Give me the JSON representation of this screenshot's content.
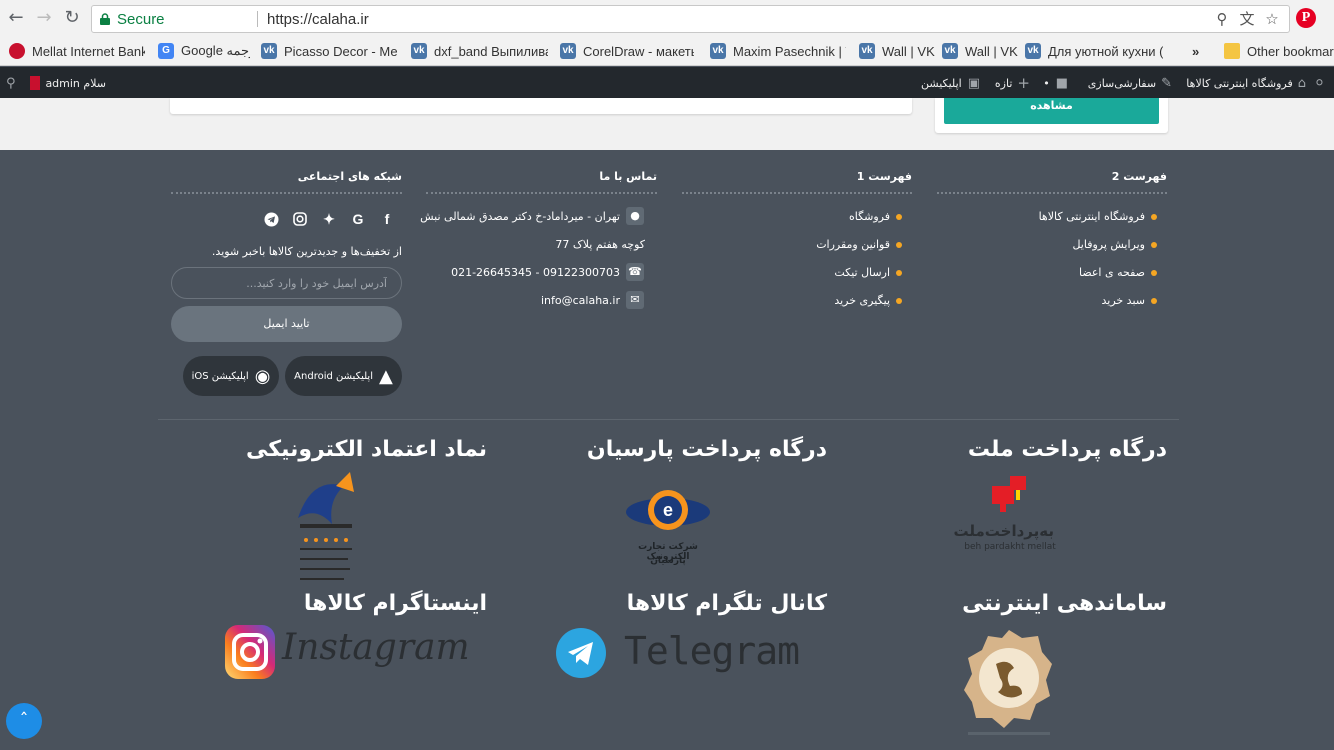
{
  "browser": {
    "secure_label": "Secure",
    "url": "https://calaha.ir",
    "bookmarks": [
      {
        "label": "Mellat Internet Banki",
        "icon": "mellat-icon"
      },
      {
        "label": "Google ترجمه",
        "icon": "google-translate-icon"
      },
      {
        "label": "Picasso Decor - Мебе",
        "icon": "vk-icon"
      },
      {
        "label": "dxf_band Выпиливан",
        "icon": "vk-icon"
      },
      {
        "label": "CorelDraw - макеты,",
        "icon": "vk-icon"
      },
      {
        "label": "Maxim Pasechnik | VK",
        "icon": "vk-icon"
      },
      {
        "label": "Wall | VK",
        "icon": "vk-icon"
      },
      {
        "label": "Wall | VK",
        "icon": "vk-icon"
      },
      {
        "label": "Для уютной кухни (n",
        "icon": "vk-icon"
      }
    ],
    "more_label": "»",
    "other_bookmarks": "Other bookmarks"
  },
  "adminbar": {
    "site_name": "فروشگاه اینترنتی کالاها",
    "customize": "سفارشی‌سازی",
    "new": "تازه",
    "app": "اپلیکیشن",
    "greeting": "سلام admin"
  },
  "page": {
    "view_button": "مشاهده"
  },
  "footer": {
    "menu2": {
      "title": "فهرست 2",
      "items": [
        "فروشگاه اینترنتی کالاها",
        "ویرایش پروفایل",
        "صفحه ی اعضا",
        "سبد خرید"
      ]
    },
    "menu1": {
      "title": "فهرست 1",
      "items": [
        "فروشگاه",
        "قوانین ومقررات",
        "ارسال تیکت",
        "پیگیری خرید"
      ]
    },
    "contact": {
      "title": "تماس با ما",
      "address_line1": "تهران - میرداماد-خ دکتر مصدق شمالی نبش",
      "address_line2": "کوچه هفتم پلاک 77",
      "phone": "09122300703 - 021-26645345",
      "email": "info@calaha.ir"
    },
    "social": {
      "title": "شبکه های اجتماعی",
      "newsletter_text": "از تخفیف‌ها و جدیدترین کالاها باخبر شوید.",
      "email_placeholder": "آدرس ایمیل خود را وارد کنید...",
      "confirm_label": "تایید ایمیل",
      "android_label": "اپلیکیشن Android",
      "ios_label": "اپلیکیشن iOS"
    },
    "badges": {
      "mellat": "درگاه پرداخت ملت",
      "parsian": "درگاه پرداخت پارسیان",
      "enamad": "نماد اعتماد الکترونیکی",
      "samandehi": "ساماندهی اینترنتی",
      "telegram": "کانال تلگرام کالاها",
      "instagram": "اینستاگرام کالاها"
    },
    "logos": {
      "mellat_fa": "به‌پرداخت‌ملت",
      "mellat_en": "beh pardakht mellat",
      "parsian_fa1": "شرکت تجارت الکترونیک",
      "parsian_fa2": "پارسیان",
      "telegram_word": "Telegram",
      "instagram_word": "Instagram"
    }
  },
  "colors": {
    "footer_bg": "#4a525c",
    "accent_teal": "#1aa99a",
    "bullet_orange": "#f5a623",
    "adminbar_bg": "#23282d"
  }
}
